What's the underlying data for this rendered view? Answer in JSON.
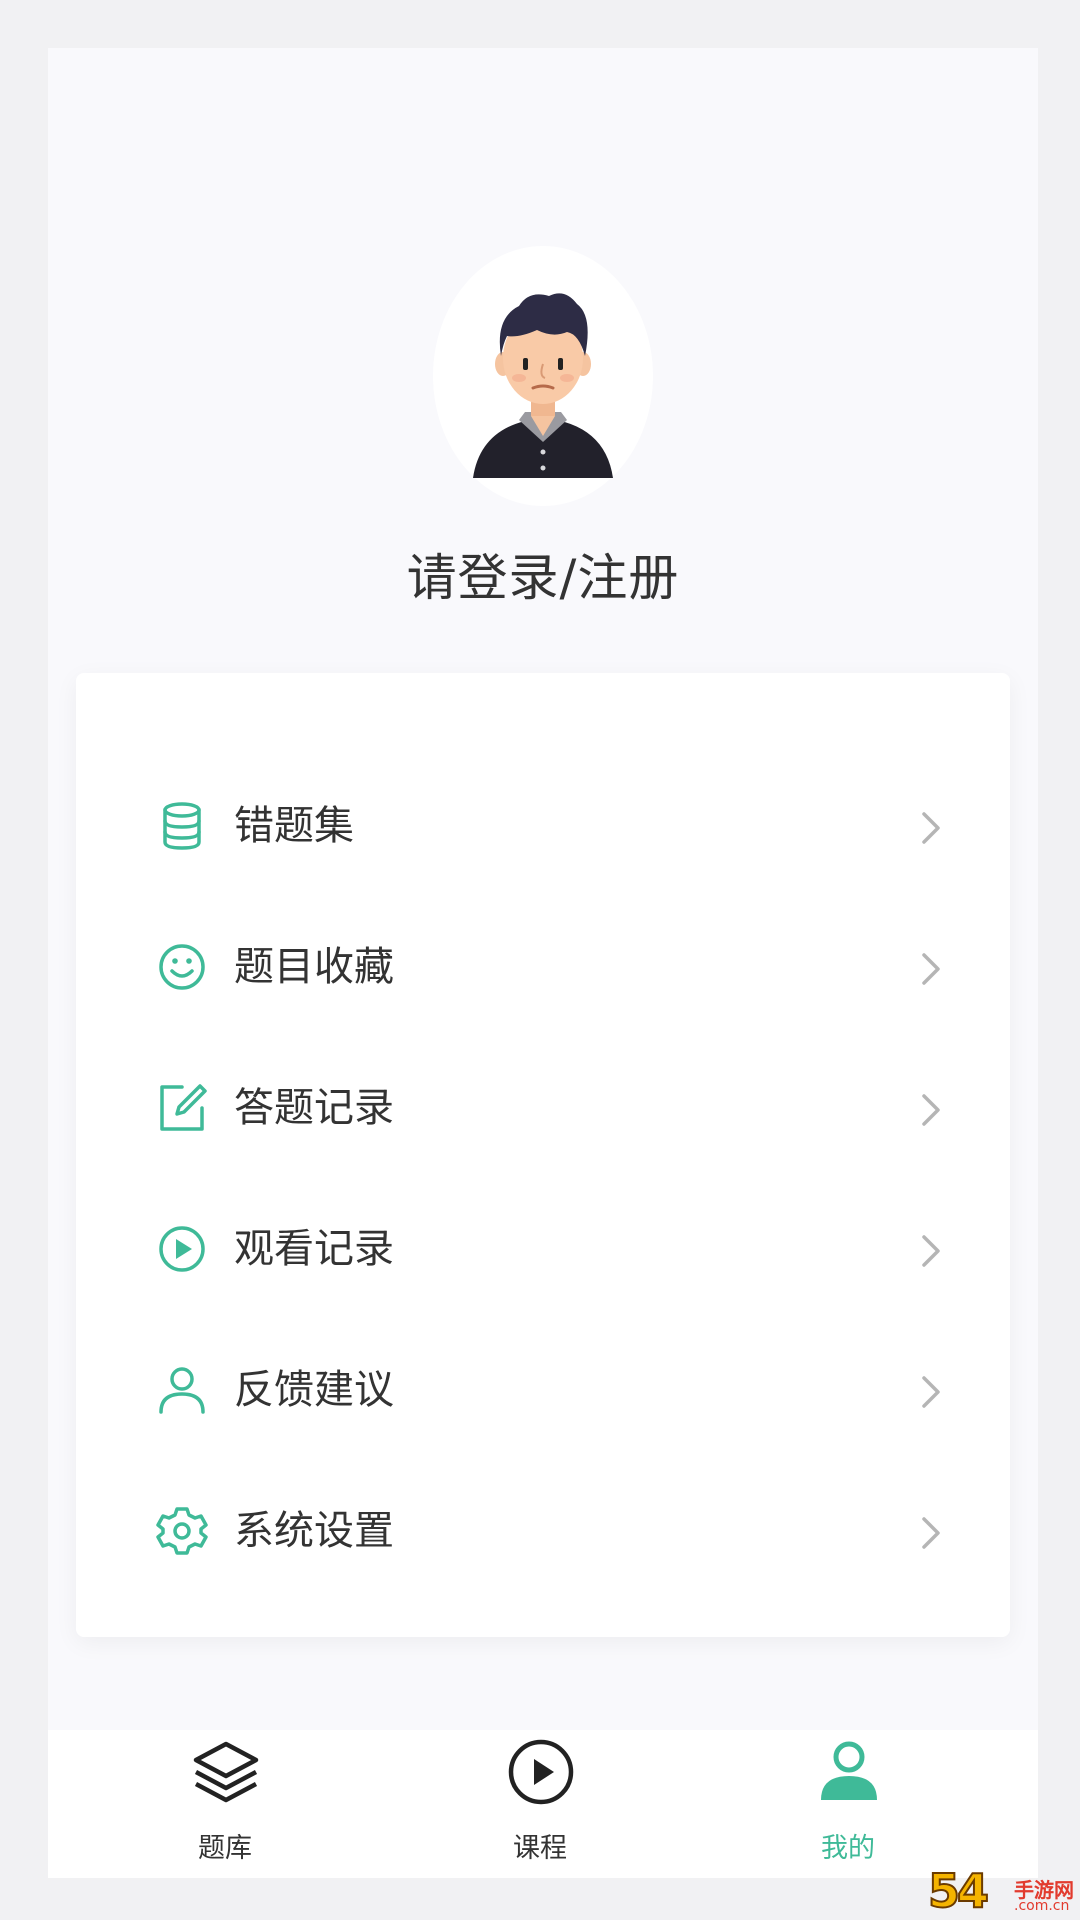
{
  "profile": {
    "login_prompt": "请登录/注册"
  },
  "menu": {
    "items": [
      {
        "label": "错题集",
        "icon": "database-icon"
      },
      {
        "label": "题目收藏",
        "icon": "smile-icon"
      },
      {
        "label": "答题记录",
        "icon": "edit-icon"
      },
      {
        "label": "观看记录",
        "icon": "play-circle-icon"
      },
      {
        "label": "反馈建议",
        "icon": "user-icon"
      },
      {
        "label": "系统设置",
        "icon": "gear-icon"
      }
    ]
  },
  "tabbar": {
    "tabs": [
      {
        "label": "题库",
        "icon": "layers-icon"
      },
      {
        "label": "课程",
        "icon": "play-circle-icon"
      },
      {
        "label": "我的",
        "icon": "user-icon",
        "active": true
      }
    ]
  },
  "watermark": {
    "number": "54",
    "site": "手游网",
    "domain": ".com.cn"
  },
  "colors": {
    "accent": "#3fba98",
    "text": "#333333",
    "chevron": "#b5b5b5"
  }
}
